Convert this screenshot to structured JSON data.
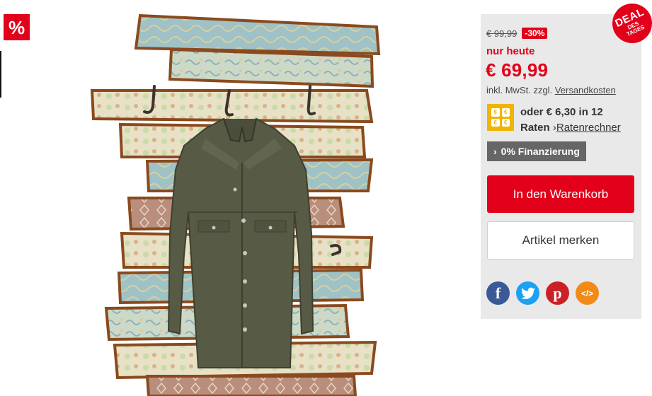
{
  "badge": {
    "sale_symbol": "%"
  },
  "deal": {
    "line1": "DEAL",
    "line2": "DES",
    "line3": "TAGES"
  },
  "price": {
    "old": "€ 99,99",
    "discount": "-30%",
    "today_label": "nur heute",
    "current": "€ 69,99",
    "vat_text": "inkl. MwSt. zzgl.",
    "shipping_link": "Versandkosten"
  },
  "installment": {
    "line1": "oder € 6,30 in 12",
    "line2": "Raten",
    "calculator_link": "Ratenrechner",
    "icon_glyph": "€"
  },
  "buttons": {
    "financing": "0% Finanzierung",
    "add_to_cart": "In den Warenkorb",
    "wishlist": "Artikel merken"
  },
  "share": {
    "facebook": "f",
    "pinterest": "p",
    "embed": "</>"
  },
  "colors": {
    "accent_red": "#e2001a",
    "installment_yellow": "#f1b400",
    "buybox_bg": "#e9e9e9"
  }
}
